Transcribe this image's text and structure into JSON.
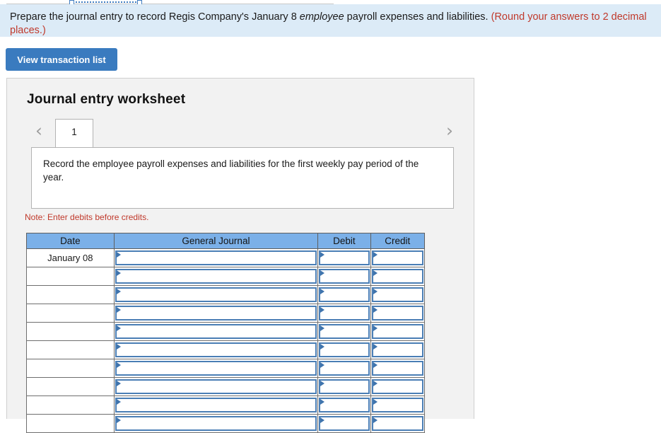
{
  "banner": {
    "text_before": "Prepare the journal entry to record Regis Company's January 8 ",
    "emphasis": "employee",
    "text_after": " payroll expenses and liabilities. ",
    "note": "(Round your answers to 2 decimal places.)"
  },
  "toolbar": {
    "view_transaction_list_label": "View transaction list"
  },
  "worksheet": {
    "title": "Journal entry worksheet",
    "prev_arrow": "‹",
    "next_arrow": "›",
    "tabs": [
      {
        "label": "1",
        "selected": true
      }
    ],
    "description": "Record the employee payroll expenses and liabilities for the first weekly pay period of the year.",
    "note": "Note: Enter debits before credits."
  },
  "table": {
    "columns": [
      "Date",
      "General Journal",
      "Debit",
      "Credit"
    ],
    "rows": [
      {
        "date": "January 08",
        "general_journal": "",
        "debit": "",
        "credit": ""
      },
      {
        "date": "",
        "general_journal": "",
        "debit": "",
        "credit": ""
      },
      {
        "date": "",
        "general_journal": "",
        "debit": "",
        "credit": ""
      },
      {
        "date": "",
        "general_journal": "",
        "debit": "",
        "credit": ""
      },
      {
        "date": "",
        "general_journal": "",
        "debit": "",
        "credit": ""
      },
      {
        "date": "",
        "general_journal": "",
        "debit": "",
        "credit": ""
      },
      {
        "date": "",
        "general_journal": "",
        "debit": "",
        "credit": ""
      },
      {
        "date": "",
        "general_journal": "",
        "debit": "",
        "credit": ""
      },
      {
        "date": "",
        "general_journal": "",
        "debit": "",
        "credit": ""
      },
      {
        "date": "",
        "general_journal": "",
        "debit": "",
        "credit": ""
      }
    ]
  },
  "colors": {
    "banner_bg": "#dcebf7",
    "button_blue": "#3a7bbf",
    "header_blue": "#7bb0e8",
    "field_border": "#4a7eb5",
    "note_red": "#c0392b",
    "card_bg": "#f2f2f2"
  }
}
